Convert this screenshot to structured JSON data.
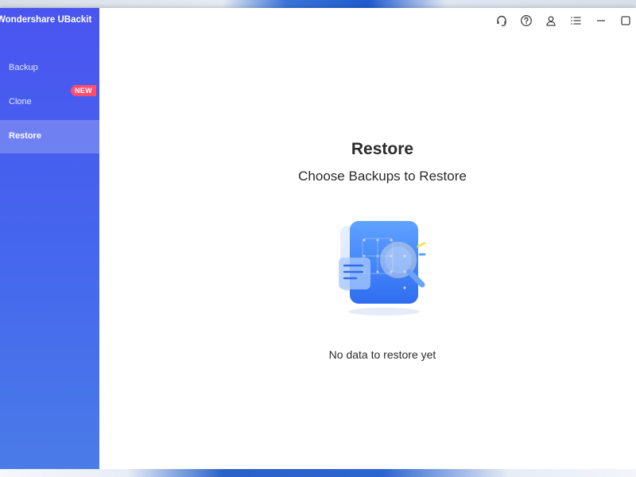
{
  "app": {
    "title": "Wondershare UBackit"
  },
  "sidebar": {
    "items": [
      {
        "id": "backup",
        "label": "Backup",
        "active": false
      },
      {
        "id": "clone",
        "label": "Clone",
        "active": false,
        "badge": "NEW"
      },
      {
        "id": "restore",
        "label": "Restore",
        "active": true
      }
    ]
  },
  "topbar": {
    "icons": [
      "headset-icon",
      "help-icon",
      "account-icon",
      "menu-icon",
      "minimize-icon",
      "maximize-icon"
    ]
  },
  "main": {
    "title": "Restore",
    "subtitle": "Choose Backups to Restore",
    "empty_message": "No data to restore yet"
  },
  "colors": {
    "sidebar_top": "#4a55f0",
    "sidebar_bottom": "#4a7be8",
    "badge": "#ff4d6d",
    "text": "#2a2a2a"
  }
}
